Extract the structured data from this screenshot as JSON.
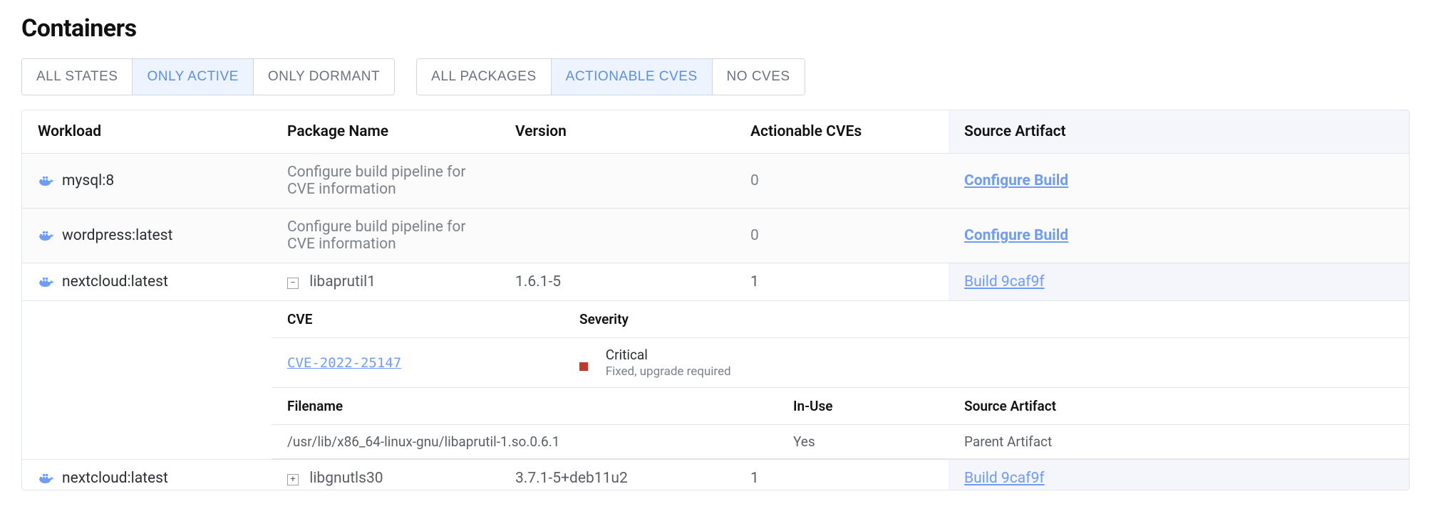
{
  "title": "Containers",
  "filters": {
    "states": [
      {
        "label": "ALL STATES",
        "active": false
      },
      {
        "label": "ONLY ACTIVE",
        "active": true
      },
      {
        "label": "ONLY DORMANT",
        "active": false
      }
    ],
    "packages": [
      {
        "label": "ALL PACKAGES",
        "active": false
      },
      {
        "label": "ACTIONABLE CVES",
        "active": true
      },
      {
        "label": "NO CVES",
        "active": false
      }
    ]
  },
  "columns": {
    "workload": "Workload",
    "package": "Package Name",
    "version": "Version",
    "cves": "Actionable CVEs",
    "artifact": "Source Artifact"
  },
  "rows": [
    {
      "workload": "mysql:8",
      "packageText": "Configure build pipeline for CVE information",
      "version": "",
      "cves": "0",
      "artifact": "Configure Build",
      "artifactStrong": true,
      "muted": true
    },
    {
      "workload": "wordpress:latest",
      "packageText": "Configure build pipeline for CVE information",
      "version": "",
      "cves": "0",
      "artifact": "Configure Build",
      "artifactStrong": true,
      "muted": true
    },
    {
      "workload": "nextcloud:latest",
      "expand": "minus",
      "packageText": "libaprutil1",
      "version": "1.6.1-5",
      "cves": "1",
      "artifact": "Build 9caf9f",
      "artifactStrong": false,
      "muted": false
    },
    {
      "workload": "nextcloud:latest",
      "expand": "plus",
      "packageText": "libgnutls30",
      "version": "3.7.1-5+deb11u2",
      "cves": "1",
      "artifact": "Build 9caf9f",
      "artifactStrong": false,
      "muted": false
    }
  ],
  "cvePanel": {
    "headers": {
      "cve": "CVE",
      "severity": "Severity"
    },
    "cveId": "CVE-2022-25147",
    "severity": "Critical",
    "severityNote": "Fixed, upgrade required"
  },
  "filePanel": {
    "headers": {
      "filename": "Filename",
      "inuse": "In-Use",
      "artifact": "Source Artifact"
    },
    "filename": "/usr/lib/x86_64-linux-gnu/libaprutil-1.so.0.6.1",
    "inuse": "Yes",
    "artifact": "Parent Artifact"
  }
}
